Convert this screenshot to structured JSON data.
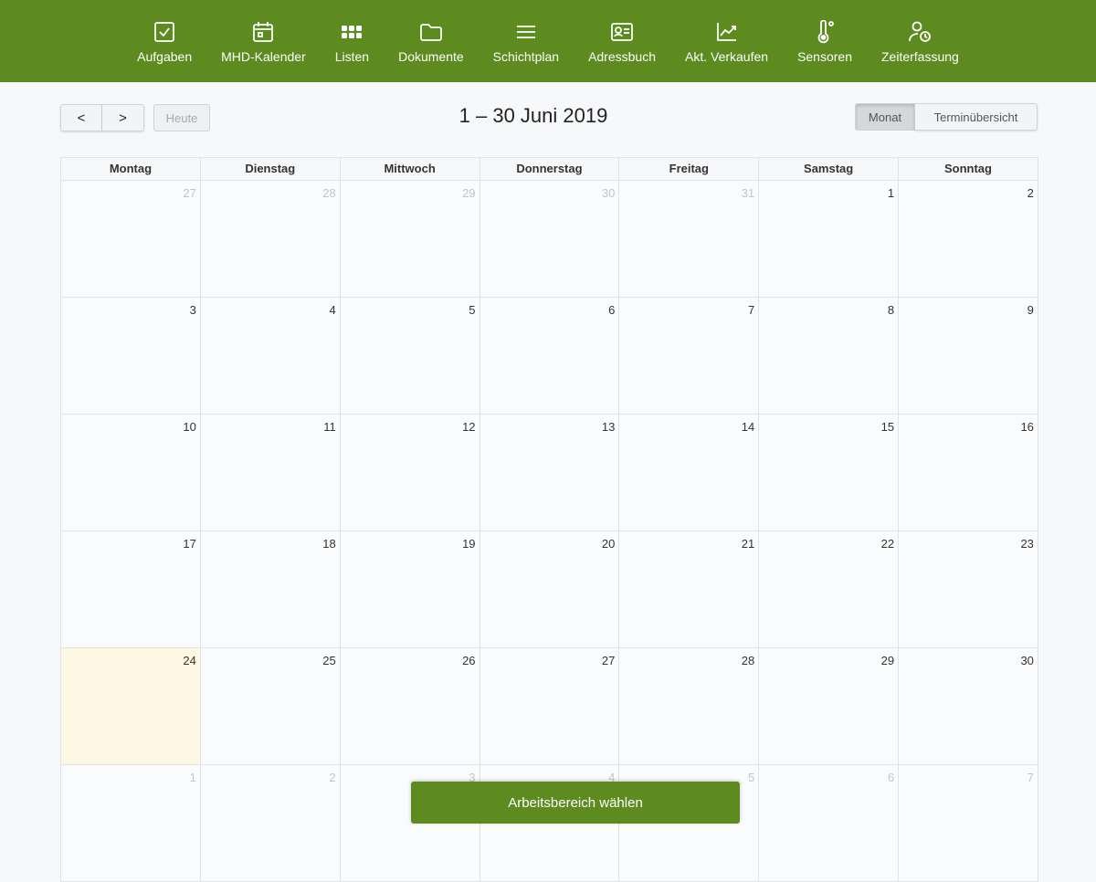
{
  "nav": {
    "items": [
      {
        "label": "Aufgaben",
        "icon": "check-square-icon"
      },
      {
        "label": "MHD-Kalender",
        "icon": "calendar-icon"
      },
      {
        "label": "Listen",
        "icon": "grid-icon"
      },
      {
        "label": "Dokumente",
        "icon": "folder-icon"
      },
      {
        "label": "Schichtplan",
        "icon": "lines-icon"
      },
      {
        "label": "Adressbuch",
        "icon": "contact-card-icon"
      },
      {
        "label": "Akt. Verkaufen",
        "icon": "trend-chart-icon"
      },
      {
        "label": "Sensoren",
        "icon": "thermometer-icon"
      },
      {
        "label": "Zeiterfassung",
        "icon": "user-clock-icon"
      }
    ]
  },
  "toolbar": {
    "prev_label": "<",
    "next_label": ">",
    "today_label": "Heute",
    "title": "1 – 30 Juni 2019",
    "view_month": "Monat",
    "view_overview": "Terminübersicht"
  },
  "calendar": {
    "weekdays": [
      "Montag",
      "Dienstag",
      "Mittwoch",
      "Donnerstag",
      "Freitag",
      "Samstag",
      "Sonntag"
    ],
    "weeks": [
      [
        {
          "d": "27",
          "o": true
        },
        {
          "d": "28",
          "o": true
        },
        {
          "d": "29",
          "o": true
        },
        {
          "d": "30",
          "o": true
        },
        {
          "d": "31",
          "o": true
        },
        {
          "d": "1"
        },
        {
          "d": "2"
        }
      ],
      [
        {
          "d": "3"
        },
        {
          "d": "4"
        },
        {
          "d": "5"
        },
        {
          "d": "6"
        },
        {
          "d": "7"
        },
        {
          "d": "8"
        },
        {
          "d": "9"
        }
      ],
      [
        {
          "d": "10"
        },
        {
          "d": "11"
        },
        {
          "d": "12"
        },
        {
          "d": "13"
        },
        {
          "d": "14"
        },
        {
          "d": "15"
        },
        {
          "d": "16"
        }
      ],
      [
        {
          "d": "17"
        },
        {
          "d": "18"
        },
        {
          "d": "19"
        },
        {
          "d": "20"
        },
        {
          "d": "21"
        },
        {
          "d": "22"
        },
        {
          "d": "23"
        }
      ],
      [
        {
          "d": "24",
          "today": true
        },
        {
          "d": "25"
        },
        {
          "d": "26"
        },
        {
          "d": "27"
        },
        {
          "d": "28"
        },
        {
          "d": "29"
        },
        {
          "d": "30"
        }
      ],
      [
        {
          "d": "1",
          "o": true
        },
        {
          "d": "2",
          "o": true
        },
        {
          "d": "3",
          "o": true
        },
        {
          "d": "4",
          "o": true
        },
        {
          "d": "5",
          "o": true
        },
        {
          "d": "6",
          "o": true
        },
        {
          "d": "7",
          "o": true
        }
      ]
    ]
  },
  "footer": {
    "workspace_label": "Arbeitsbereich wählen"
  },
  "colors": {
    "brand": "#5d8b1f",
    "today": "#fdf7e3"
  }
}
